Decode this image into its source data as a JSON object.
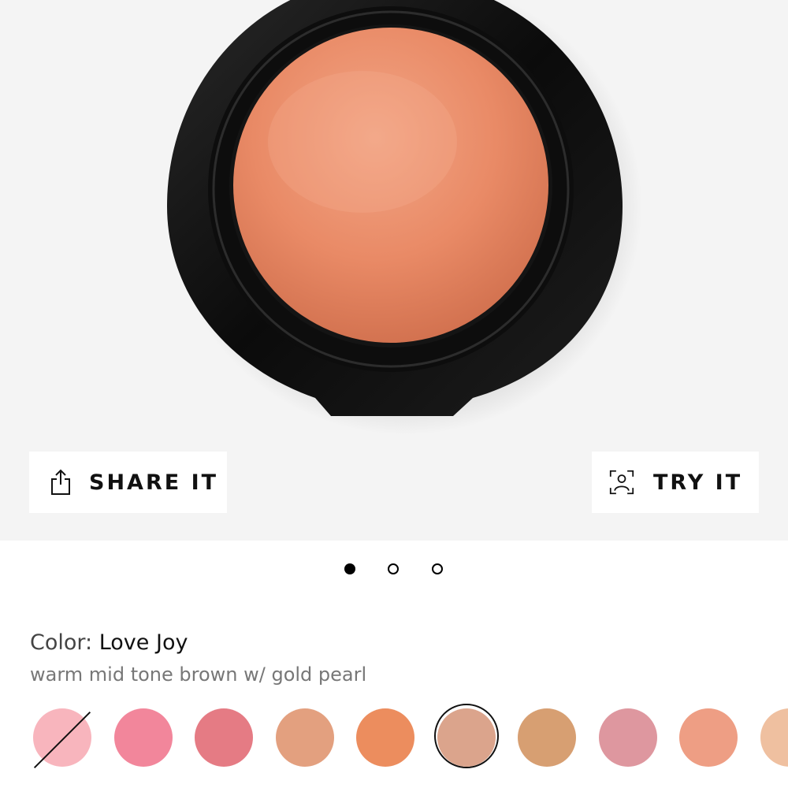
{
  "product_image": {
    "label": ""
  },
  "actions": {
    "share": {
      "label": "SHARE IT",
      "icon": "share-icon"
    },
    "try": {
      "label": "TRY IT",
      "icon": "face-scan-icon"
    }
  },
  "carousel": {
    "total": 3,
    "active_index": 0
  },
  "color": {
    "label": "Color:",
    "value": "Love Joy",
    "description": "warm mid tone brown w/ gold pearl"
  },
  "swatches": [
    {
      "color": "#f8b5bd",
      "unavailable": true,
      "selected": false
    },
    {
      "color": "#f2869b",
      "unavailable": false,
      "selected": false
    },
    {
      "color": "#e57b84",
      "unavailable": false,
      "selected": false
    },
    {
      "color": "#e3a07f",
      "unavailable": false,
      "selected": false
    },
    {
      "color": "#ec8d5e",
      "unavailable": false,
      "selected": false
    },
    {
      "color": "#dba48c",
      "unavailable": false,
      "selected": true
    },
    {
      "color": "#d79f72",
      "unavailable": false,
      "selected": false
    },
    {
      "color": "#de979f",
      "unavailable": false,
      "selected": false
    },
    {
      "color": "#ee9e84",
      "unavailable": false,
      "selected": false
    },
    {
      "color": "#efc0a0",
      "unavailable": false,
      "selected": false
    }
  ]
}
